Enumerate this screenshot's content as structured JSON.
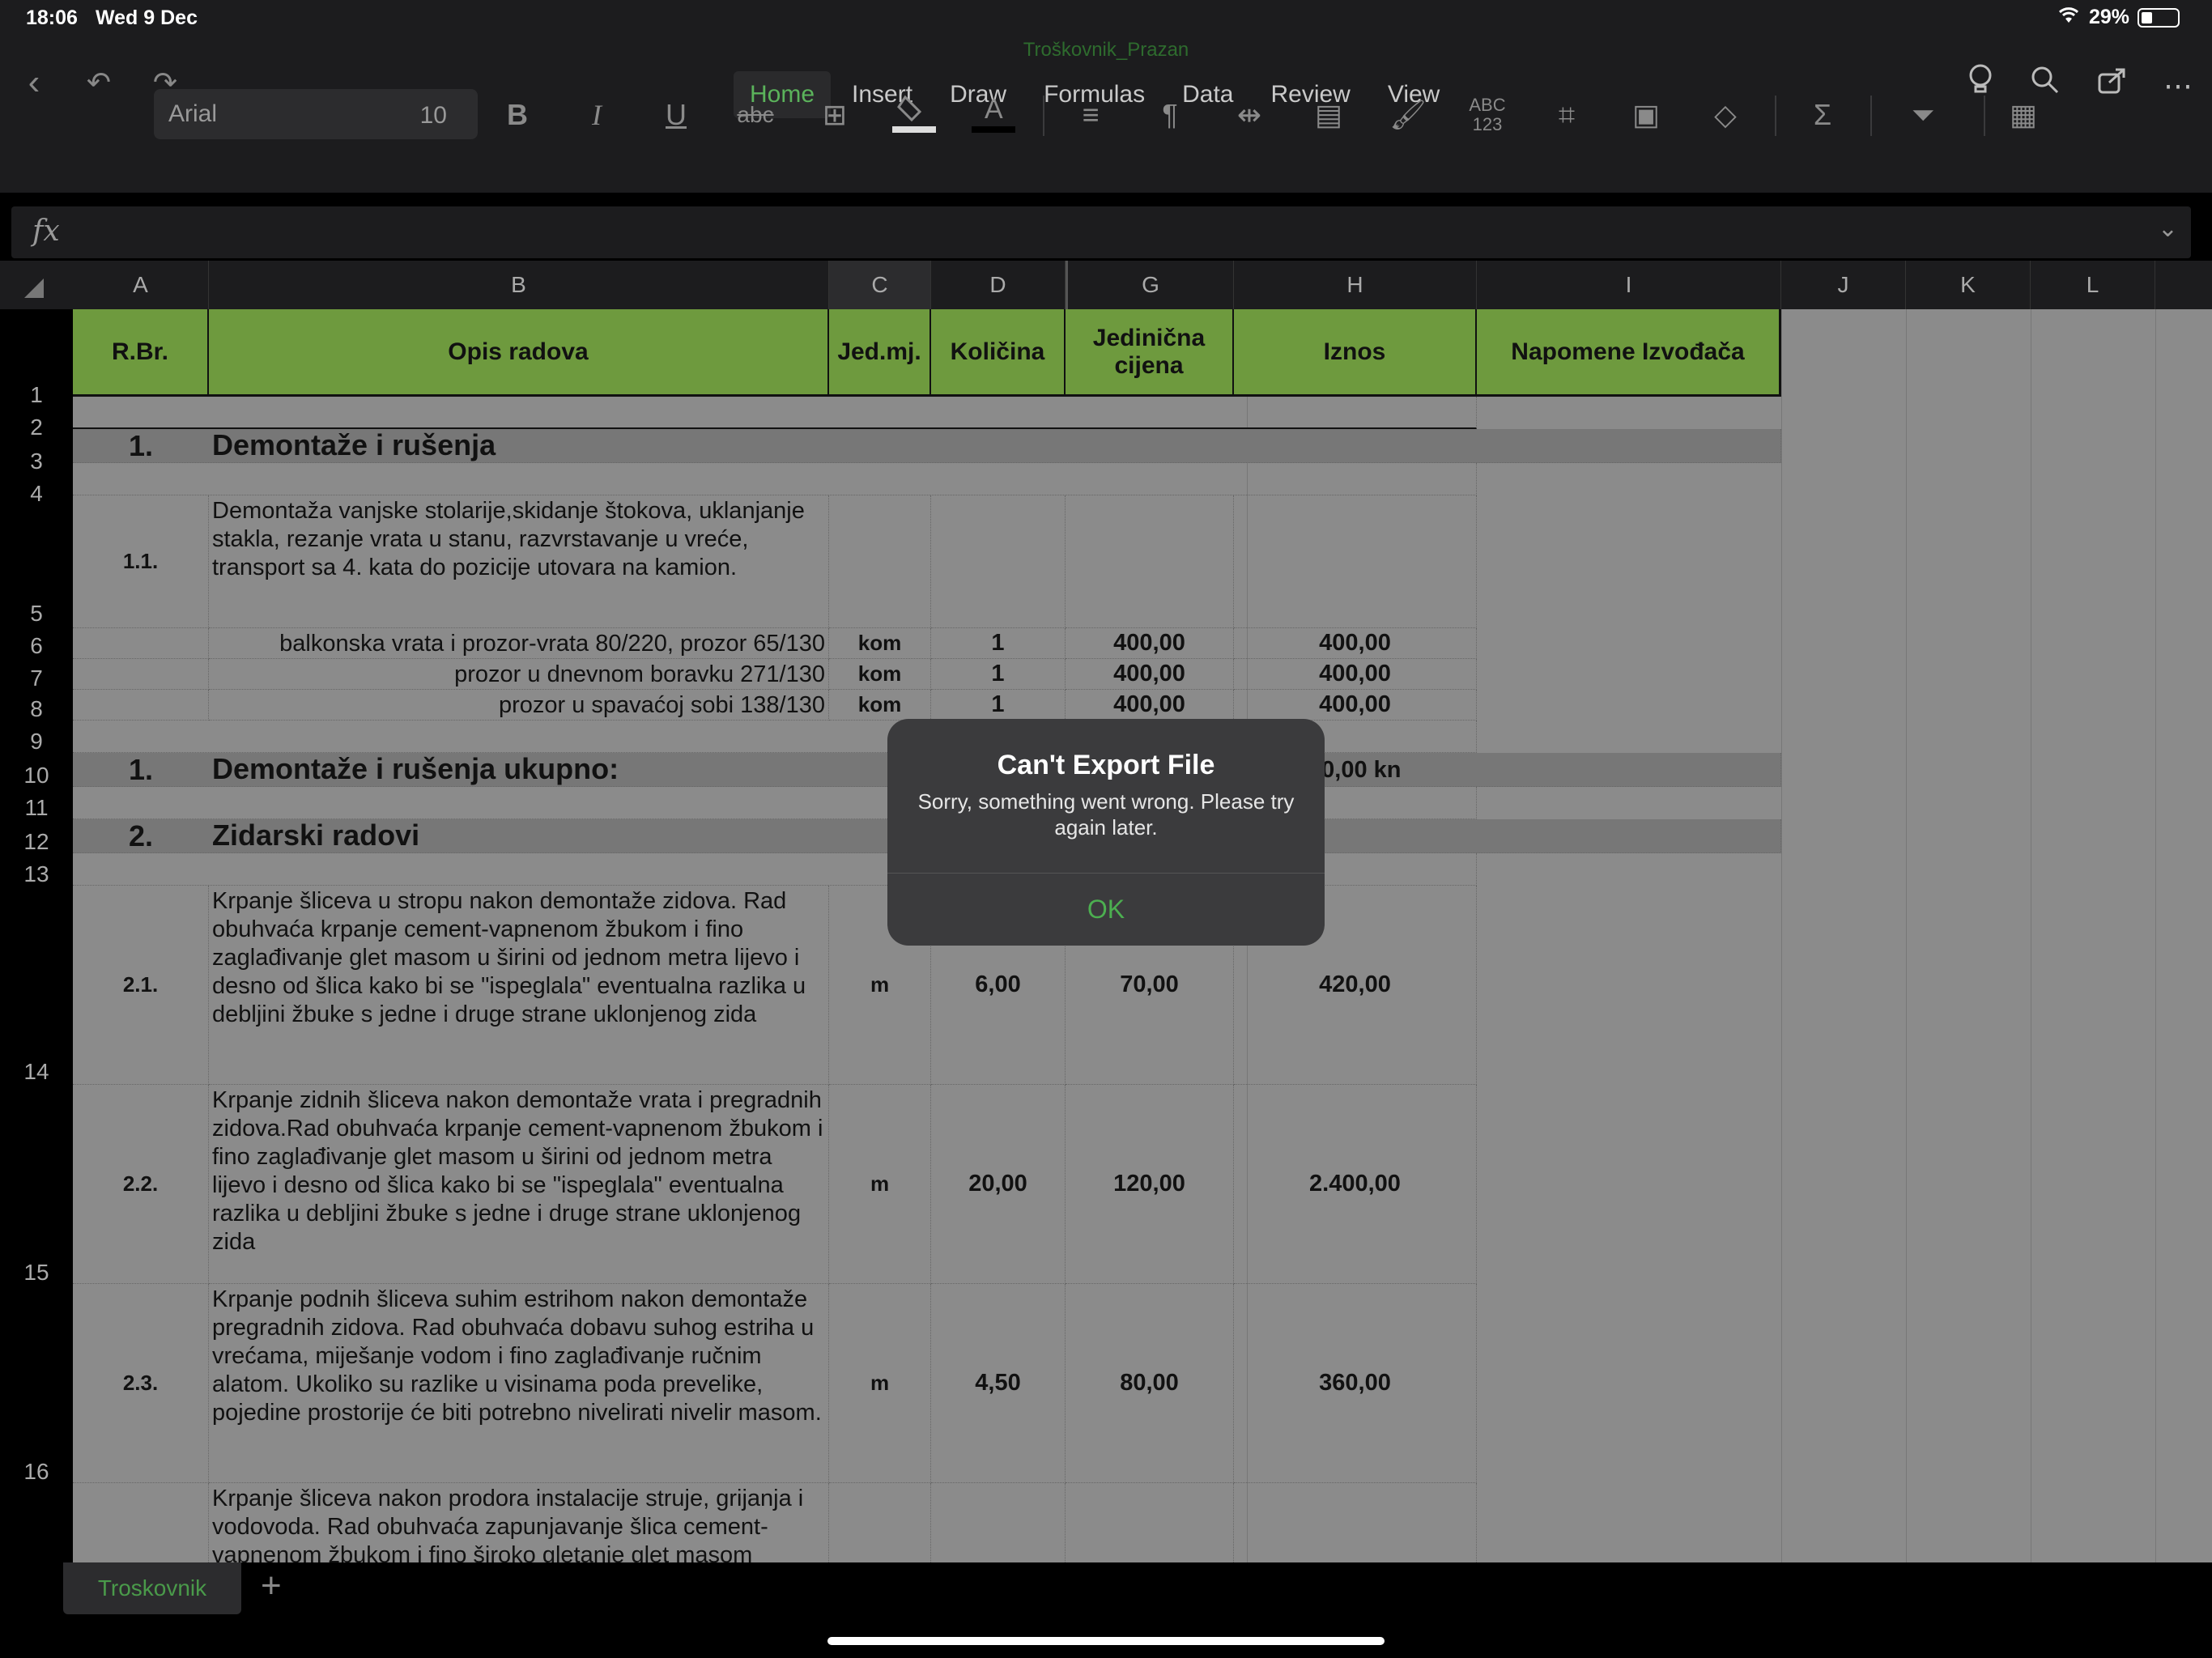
{
  "status": {
    "time": "18:06",
    "date": "Wed 9 Dec",
    "battery": "29%"
  },
  "document": {
    "title": "Troškovnik_Prazan"
  },
  "ribbon": {
    "tabs": [
      "Home",
      "Insert",
      "Draw",
      "Formulas",
      "Data",
      "Review",
      "View"
    ],
    "active_tab": "Home",
    "font_name": "Arial",
    "font_size": "10"
  },
  "columns": [
    "A",
    "B",
    "C",
    "D",
    "G",
    "H",
    "I",
    "J",
    "K",
    "L"
  ],
  "rows": [
    "1",
    "2",
    "3",
    "4",
    "5",
    "6",
    "7",
    "8",
    "9",
    "10",
    "11",
    "12",
    "13",
    "14",
    "15",
    "16"
  ],
  "header": {
    "rbr": "R.Br.",
    "opis": "Opis radova",
    "jedmj": "Jed.mj.",
    "kolicina": "Količina",
    "jedinicna": "Jedinična cijena",
    "iznos": "Iznos",
    "napomene": "Napomene Izvođača"
  },
  "sections": {
    "s1_num": "1.",
    "s1_title": "Demontaže i rušenja",
    "s1_total_num": "1.",
    "s1_total_title": "Demontaže i rušenja ukupno:",
    "s1_total_value": "00,00 kn",
    "s2_num": "2.",
    "s2_title": "Zidarski radovi"
  },
  "items": {
    "i11_num": "1.1.",
    "i11_desc": "Demontaža vanjske stolarije,skidanje štokova, uklanjanje stakla, rezanje vrata u stanu, razvrstavanje u vreće, transport sa 4. kata do pozicije utovara na kamion.",
    "r6_desc": "balkonska vrata i prozor-vrata 80/220, prozor 65/130",
    "r6_unit": "kom",
    "r6_qty": "1",
    "r6_price": "400,00",
    "r6_total": "400,00",
    "r7_desc": "prozor u dnevnom boravku 271/130",
    "r7_unit": "kom",
    "r7_qty": "1",
    "r7_price": "400,00",
    "r7_total": "400,00",
    "r8_desc": "prozor u spavaćoj sobi 138/130",
    "r8_unit": "kom",
    "r8_qty": "1",
    "r8_price": "400,00",
    "r8_total": "400,00",
    "i21_num": "2.1.",
    "i21_desc": "Krpanje šliceva u stropu nakon demontaže zidova. Rad obuhvaća krpanje cement-vapnenom žbukom i fino zaglađivanje glet masom u širini od jednom metra lijevo i desno od šlica kako bi se \"ispeglala\" eventualna razlika u debljini žbuke s jedne i druge strane uklonjenog zida",
    "i21_unit": "m",
    "i21_qty": "6,00",
    "i21_price": "70,00",
    "i21_total": "420,00",
    "i22_num": "2.2.",
    "i22_desc": "Krpanje zidnih šliceva nakon demontaže vrata i pregradnih zidova.Rad obuhvaća krpanje cement-vapnenom žbukom i fino zaglađivanje glet masom u širini od jednom metra lijevo i desno od šlica kako bi se \"ispeglala\" eventualna razlika u debljini žbuke s jedne i druge strane uklonjenog zida",
    "i22_unit": "m",
    "i22_qty": "20,00",
    "i22_price": "120,00",
    "i22_total": "2.400,00",
    "i23_num": "2.3.",
    "i23_desc": "Krpanje podnih šliceva suhim estrihom nakon demontaže pregradnih zidova. Rad obuhvaća dobavu suhog estriha u vrećama, miješanje vodom i fino zaglađivanje ručnim alatom. Ukoliko su razlike u visinama poda prevelike, pojedine prostorije će biti potrebno nivelirati nivelir masom.",
    "i23_unit": "m",
    "i23_qty": "4,50",
    "i23_price": "80,00",
    "i23_total": "360,00",
    "i24_desc": "Krpanje šliceva nakon prodora instalacije struje, grijanja i vodovoda. Rad obuhvaća zapunjavanje šlica cement-vapnenom žbukom i fino široko gletanje glet masom"
  },
  "sheets": {
    "active": "Troskovnik"
  },
  "alert": {
    "title": "Can't Export File",
    "message": "Sorry, something went wrong. Please try again later.",
    "ok": "OK"
  }
}
